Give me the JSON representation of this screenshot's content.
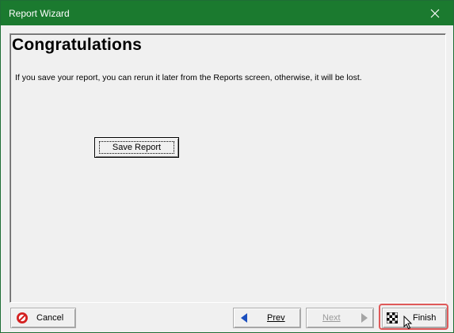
{
  "window": {
    "title": "Report Wizard",
    "close_icon": "close-icon"
  },
  "content": {
    "heading": "Congratulations",
    "message": "If you save your report, you can rerun it later from the Reports screen, otherwise, it will be lost.",
    "save_button_label": "Save Report"
  },
  "footer": {
    "cancel_label": "Cancel",
    "cancel_icon": "cancel-icon",
    "prev_label": "Prev",
    "prev_icon": "arrow-left-icon",
    "next_label": "Next",
    "next_icon": "arrow-right-icon",
    "next_enabled": false,
    "finish_label": "Finish",
    "finish_icon": "checkered-flag-icon"
  },
  "colors": {
    "titlebar": "#1b7a2f",
    "highlight": "#e05a5a",
    "cancel_icon": "#d42121",
    "arrow_icon": "#1b4fbf"
  }
}
